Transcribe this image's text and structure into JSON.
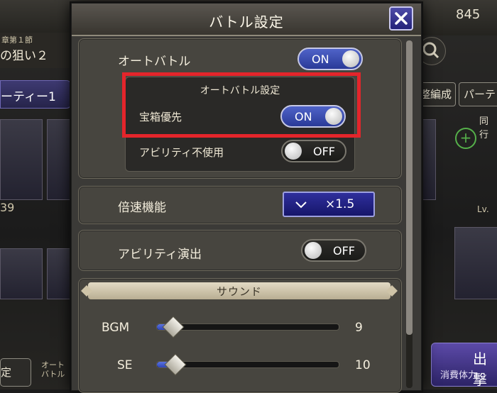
{
  "background": {
    "currency_count": "845",
    "chapter_small": "章第１節",
    "chapter_title": "の狙い２",
    "party_tab": "ーティー1",
    "right_btn_1": "整編成",
    "right_btn_2": "パーテ",
    "same_row_label": "同行",
    "lv_label": "Lv.",
    "number_label": "39",
    "bottom_left": "定",
    "bottom_mid": "オート\nバトル",
    "sortie_label": "出撃",
    "stamina_label": "消費体力"
  },
  "modal": {
    "title": "バトル設定",
    "auto_battle": {
      "label": "オートバトル",
      "state": "ON"
    },
    "auto_settings": {
      "title": "オートバトル設定",
      "treasure": {
        "label": "宝箱優先",
        "state": "ON"
      },
      "no_ability": {
        "label": "アビリティ不使用",
        "state": "OFF"
      }
    },
    "speed": {
      "label": "倍速機能",
      "value": "×1.5"
    },
    "ability_effect": {
      "label": "アビリティ演出",
      "state": "OFF"
    },
    "sound": {
      "title": "サウンド",
      "bgm": {
        "label": "BGM",
        "value": "9",
        "level": 0.09
      },
      "se": {
        "label": "SE",
        "value": "10",
        "level": 0.1
      }
    }
  },
  "colors": {
    "accent_on": "#3a4fb8",
    "highlight": "#e4252b"
  },
  "icons": [
    "close-icon",
    "chevron-down-icon",
    "search-icon",
    "plus-icon"
  ]
}
